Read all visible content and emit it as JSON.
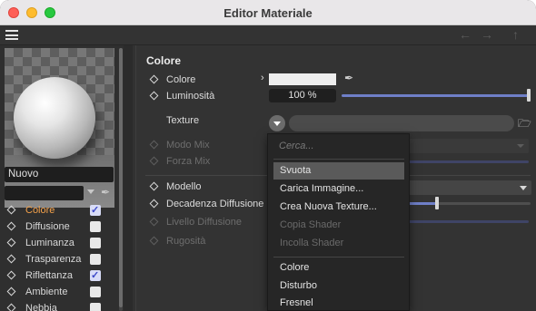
{
  "window": {
    "title": "Editor Materiale"
  },
  "material": {
    "name": "Nuovo"
  },
  "channels": [
    {
      "label": "Colore",
      "checked": true,
      "active": true
    },
    {
      "label": "Diffusione",
      "checked": false,
      "active": false
    },
    {
      "label": "Luminanza",
      "checked": false,
      "active": false
    },
    {
      "label": "Trasparenza",
      "checked": false,
      "active": false
    },
    {
      "label": "Riflettanza",
      "checked": true,
      "active": false
    },
    {
      "label": "Ambiente",
      "checked": false,
      "active": false
    },
    {
      "label": "Nebbia",
      "checked": false,
      "active": false
    }
  ],
  "panel": {
    "section_title": "Colore",
    "color_label": "Colore",
    "color_value": "#eeeeee",
    "brightness_label": "Luminosità",
    "brightness_value": "100 %",
    "texture_label": "Texture",
    "mix_mode_label": "Modo Mix",
    "mix_strength_label": "Forza Mix",
    "model_label": "Modello",
    "decay_label": "Decadenza Diffusione",
    "diffuse_level_label": "Livello Diffusione",
    "roughness_label": "Rugosità"
  },
  "menu": {
    "search_placeholder": "Cerca...",
    "items": [
      {
        "label": "Svuota",
        "highlighted": true,
        "disabled": false
      },
      {
        "label": "Carica Immagine...",
        "highlighted": false,
        "disabled": false
      },
      {
        "label": "Crea Nuova Texture...",
        "highlighted": false,
        "disabled": false
      },
      {
        "label": "Copia Shader",
        "highlighted": false,
        "disabled": true
      },
      {
        "label": "Incolla Shader",
        "highlighted": false,
        "disabled": true
      }
    ],
    "shader_items": [
      {
        "label": "Colore"
      },
      {
        "label": "Disturbo"
      },
      {
        "label": "Fresnel"
      }
    ]
  },
  "colors": {
    "accent_slider": "#6f7fc8",
    "active_channel": "#f4a14a",
    "checkbox_check": "#3b48c8"
  }
}
